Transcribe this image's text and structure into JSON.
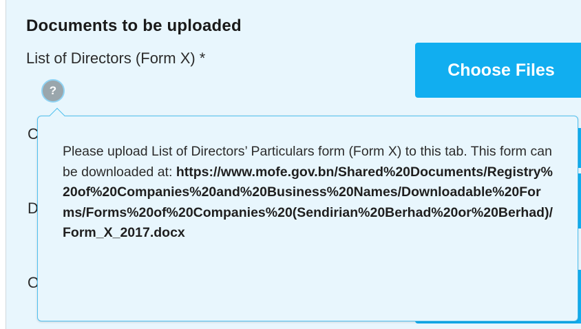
{
  "section": {
    "title": "Documents to be uploaded"
  },
  "field": {
    "label": "List of Directors (Form X) *",
    "help_icon_glyph": "?",
    "choose_files_label": "Choose Files"
  },
  "partial_labels": [
    "C",
    "D",
    "O"
  ],
  "tooltip": {
    "text": "Please upload List of Directors’ Particulars form (Form X) to this tab. This form can be downloaded at:",
    "url": "https://www.mofe.gov.bn/Shared%20Documents/Registry%20of%20Companies%20and%20Business%20Names/Downloadable%20Forms/Forms%20of%20Companies%20(Sendirian%20Berhad%20or%20Berhad)/Form_X_2017.docx"
  },
  "colors": {
    "panel_bg": "#e8f6fd",
    "accent": "#11aef0",
    "tooltip_border": "#4fc0ef"
  },
  "icons": {
    "help": "question-mark-circle"
  }
}
